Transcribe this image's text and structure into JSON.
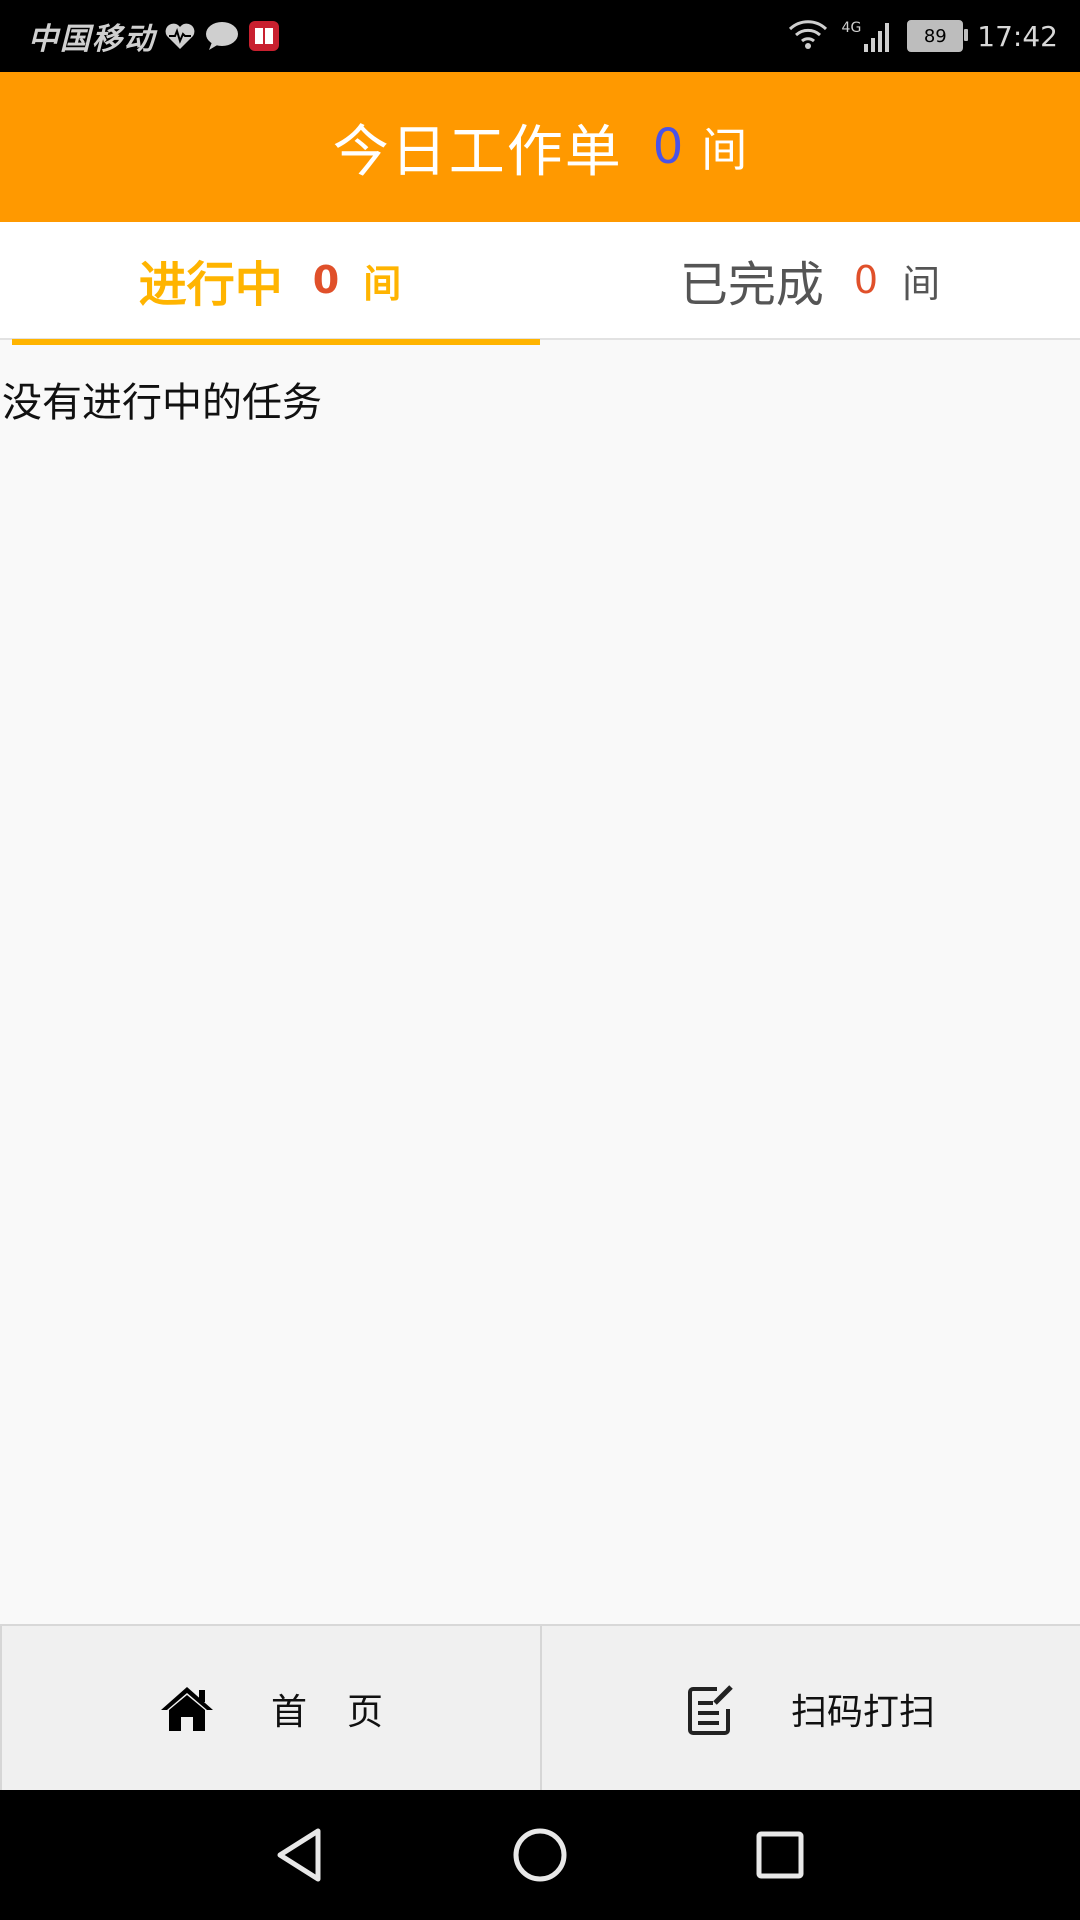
{
  "status_bar": {
    "carrier": "中国移动",
    "network": "4G",
    "battery": "89",
    "time": "17:42"
  },
  "header": {
    "title": "今日工作单",
    "count": "0",
    "unit": "间",
    "background_color": "#ff9900",
    "count_color": "#4a53e6"
  },
  "tabs": [
    {
      "label": "进行中",
      "count": "0",
      "unit": "间",
      "active": true
    },
    {
      "label": "已完成",
      "count": "0",
      "unit": "间",
      "active": false
    }
  ],
  "content": {
    "empty_message": "没有进行中的任务"
  },
  "bottom_nav": {
    "items": [
      {
        "label": "首页",
        "icon": "home-icon"
      },
      {
        "label": "扫码打扫",
        "icon": "clipboard-edit-icon"
      }
    ]
  },
  "system_nav": {
    "icons": [
      "back-icon",
      "home-circle-icon",
      "recents-icon"
    ]
  },
  "colors": {
    "accent": "#ffb400",
    "count_red": "#e0502a"
  }
}
